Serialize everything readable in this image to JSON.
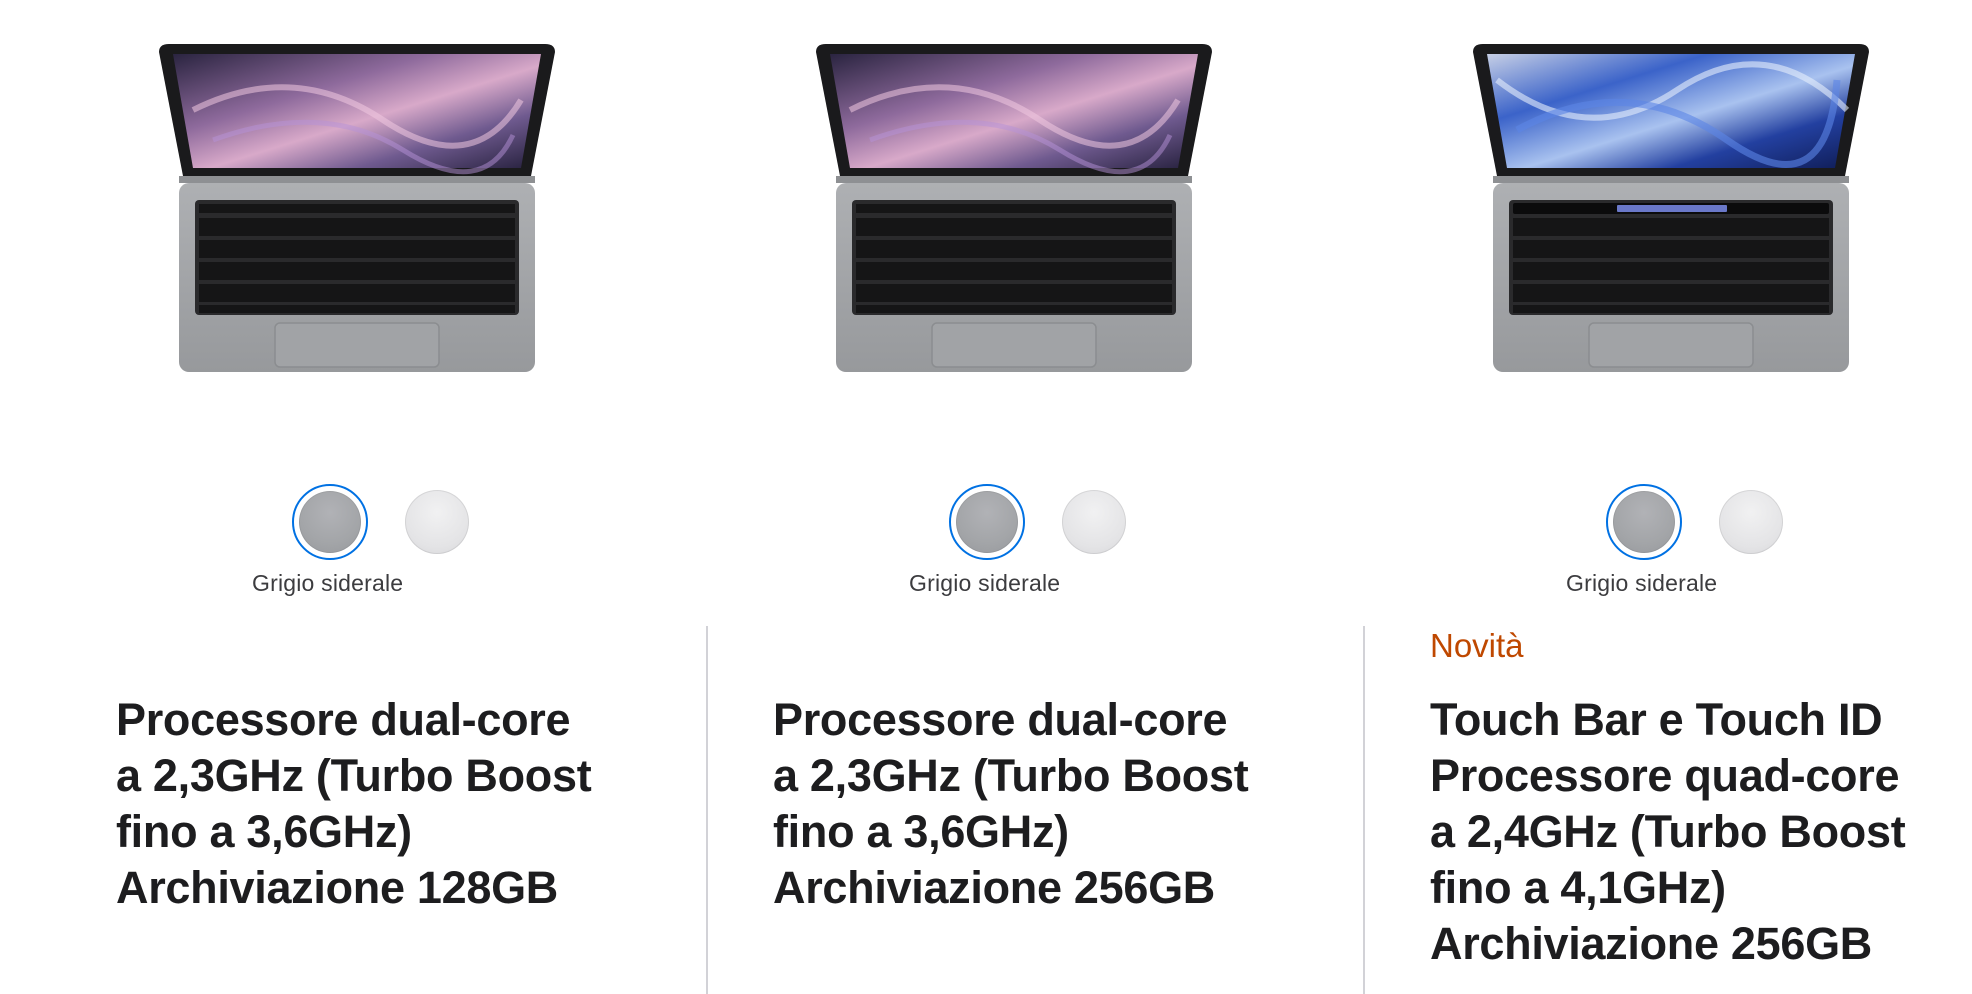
{
  "products": [
    {
      "color_options": [
        "space-gray",
        "silver"
      ],
      "selected_color_label": "Grigio siderale",
      "badge": "",
      "spec_lines": [
        "Processore dual-core",
        "a 2,3GHz (Turbo Boost",
        "fino a 3,6GHz)",
        "Archiviazione 128GB"
      ],
      "screen_variant": "purple-wallpaper",
      "touch_bar": false
    },
    {
      "color_options": [
        "space-gray",
        "silver"
      ],
      "selected_color_label": "Grigio siderale",
      "badge": "",
      "spec_lines": [
        "Processore dual-core",
        "a 2,3GHz (Turbo Boost",
        "fino a 3,6GHz)",
        "Archiviazione 256GB"
      ],
      "screen_variant": "purple-wallpaper",
      "touch_bar": false
    },
    {
      "color_options": [
        "space-gray",
        "silver"
      ],
      "selected_color_label": "Grigio siderale",
      "badge": "Novità",
      "spec_lines": [
        "Touch Bar e Touch ID",
        "Processore quad-core",
        "a 2,4GHz (Turbo Boost",
        "fino a 4,1GHz)",
        "Archiviazione 256GB"
      ],
      "screen_variant": "blue-wallpaper",
      "touch_bar": true
    }
  ],
  "colors": {
    "selection_ring": "#0071e3",
    "badge_new": "#bf4800",
    "space_gray": "#a3a5a8",
    "silver": "#e4e4e6",
    "text_primary": "#1d1d1f",
    "divider": "#d2d2d7"
  }
}
